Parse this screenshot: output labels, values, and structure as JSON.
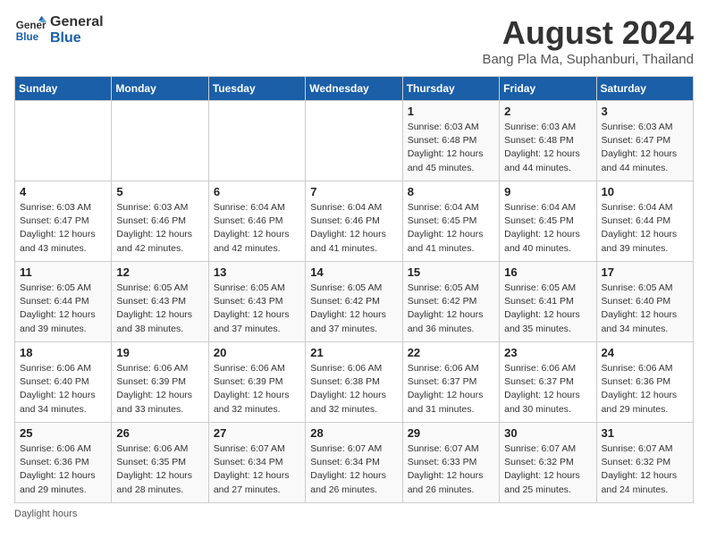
{
  "logo": {
    "line1": "General",
    "line2": "Blue"
  },
  "title": "August 2024",
  "subtitle": "Bang Pla Ma, Suphanburi, Thailand",
  "weekdays": [
    "Sunday",
    "Monday",
    "Tuesday",
    "Wednesday",
    "Thursday",
    "Friday",
    "Saturday"
  ],
  "weeks": [
    [
      {
        "day": "",
        "info": ""
      },
      {
        "day": "",
        "info": ""
      },
      {
        "day": "",
        "info": ""
      },
      {
        "day": "",
        "info": ""
      },
      {
        "day": "1",
        "info": "Sunrise: 6:03 AM\nSunset: 6:48 PM\nDaylight: 12 hours\nand 45 minutes."
      },
      {
        "day": "2",
        "info": "Sunrise: 6:03 AM\nSunset: 6:48 PM\nDaylight: 12 hours\nand 44 minutes."
      },
      {
        "day": "3",
        "info": "Sunrise: 6:03 AM\nSunset: 6:47 PM\nDaylight: 12 hours\nand 44 minutes."
      }
    ],
    [
      {
        "day": "4",
        "info": "Sunrise: 6:03 AM\nSunset: 6:47 PM\nDaylight: 12 hours\nand 43 minutes."
      },
      {
        "day": "5",
        "info": "Sunrise: 6:03 AM\nSunset: 6:46 PM\nDaylight: 12 hours\nand 42 minutes."
      },
      {
        "day": "6",
        "info": "Sunrise: 6:04 AM\nSunset: 6:46 PM\nDaylight: 12 hours\nand 42 minutes."
      },
      {
        "day": "7",
        "info": "Sunrise: 6:04 AM\nSunset: 6:46 PM\nDaylight: 12 hours\nand 41 minutes."
      },
      {
        "day": "8",
        "info": "Sunrise: 6:04 AM\nSunset: 6:45 PM\nDaylight: 12 hours\nand 41 minutes."
      },
      {
        "day": "9",
        "info": "Sunrise: 6:04 AM\nSunset: 6:45 PM\nDaylight: 12 hours\nand 40 minutes."
      },
      {
        "day": "10",
        "info": "Sunrise: 6:04 AM\nSunset: 6:44 PM\nDaylight: 12 hours\nand 39 minutes."
      }
    ],
    [
      {
        "day": "11",
        "info": "Sunrise: 6:05 AM\nSunset: 6:44 PM\nDaylight: 12 hours\nand 39 minutes."
      },
      {
        "day": "12",
        "info": "Sunrise: 6:05 AM\nSunset: 6:43 PM\nDaylight: 12 hours\nand 38 minutes."
      },
      {
        "day": "13",
        "info": "Sunrise: 6:05 AM\nSunset: 6:43 PM\nDaylight: 12 hours\nand 37 minutes."
      },
      {
        "day": "14",
        "info": "Sunrise: 6:05 AM\nSunset: 6:42 PM\nDaylight: 12 hours\nand 37 minutes."
      },
      {
        "day": "15",
        "info": "Sunrise: 6:05 AM\nSunset: 6:42 PM\nDaylight: 12 hours\nand 36 minutes."
      },
      {
        "day": "16",
        "info": "Sunrise: 6:05 AM\nSunset: 6:41 PM\nDaylight: 12 hours\nand 35 minutes."
      },
      {
        "day": "17",
        "info": "Sunrise: 6:05 AM\nSunset: 6:40 PM\nDaylight: 12 hours\nand 34 minutes."
      }
    ],
    [
      {
        "day": "18",
        "info": "Sunrise: 6:06 AM\nSunset: 6:40 PM\nDaylight: 12 hours\nand 34 minutes."
      },
      {
        "day": "19",
        "info": "Sunrise: 6:06 AM\nSunset: 6:39 PM\nDaylight: 12 hours\nand 33 minutes."
      },
      {
        "day": "20",
        "info": "Sunrise: 6:06 AM\nSunset: 6:39 PM\nDaylight: 12 hours\nand 32 minutes."
      },
      {
        "day": "21",
        "info": "Sunrise: 6:06 AM\nSunset: 6:38 PM\nDaylight: 12 hours\nand 32 minutes."
      },
      {
        "day": "22",
        "info": "Sunrise: 6:06 AM\nSunset: 6:37 PM\nDaylight: 12 hours\nand 31 minutes."
      },
      {
        "day": "23",
        "info": "Sunrise: 6:06 AM\nSunset: 6:37 PM\nDaylight: 12 hours\nand 30 minutes."
      },
      {
        "day": "24",
        "info": "Sunrise: 6:06 AM\nSunset: 6:36 PM\nDaylight: 12 hours\nand 29 minutes."
      }
    ],
    [
      {
        "day": "25",
        "info": "Sunrise: 6:06 AM\nSunset: 6:36 PM\nDaylight: 12 hours\nand 29 minutes."
      },
      {
        "day": "26",
        "info": "Sunrise: 6:06 AM\nSunset: 6:35 PM\nDaylight: 12 hours\nand 28 minutes."
      },
      {
        "day": "27",
        "info": "Sunrise: 6:07 AM\nSunset: 6:34 PM\nDaylight: 12 hours\nand 27 minutes."
      },
      {
        "day": "28",
        "info": "Sunrise: 6:07 AM\nSunset: 6:34 PM\nDaylight: 12 hours\nand 26 minutes."
      },
      {
        "day": "29",
        "info": "Sunrise: 6:07 AM\nSunset: 6:33 PM\nDaylight: 12 hours\nand 26 minutes."
      },
      {
        "day": "30",
        "info": "Sunrise: 6:07 AM\nSunset: 6:32 PM\nDaylight: 12 hours\nand 25 minutes."
      },
      {
        "day": "31",
        "info": "Sunrise: 6:07 AM\nSunset: 6:32 PM\nDaylight: 12 hours\nand 24 minutes."
      }
    ]
  ],
  "footer": "Daylight hours"
}
